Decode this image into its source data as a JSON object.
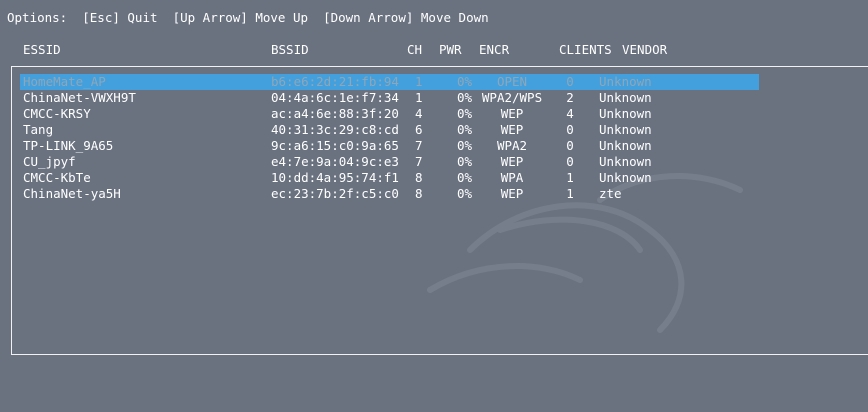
{
  "options_line": "Options:  [Esc] Quit  [Up Arrow] Move Up  [Down Arrow] Move Down",
  "columns": {
    "essid": "ESSID",
    "bssid": "BSSID",
    "ch": "CH",
    "pwr": "PWR",
    "encr": "ENCR",
    "clients": "CLIENTS",
    "vendor": "VENDOR"
  },
  "networks": [
    {
      "essid": "HomeMate_AP",
      "bssid": "b6:e6:2d:21:fb:94",
      "ch": "1",
      "pwr": "0%",
      "encr": "OPEN",
      "clients": "0",
      "vendor": "Unknown",
      "selected": true
    },
    {
      "essid": "ChinaNet-VWXH9T",
      "bssid": "04:4a:6c:1e:f7:34",
      "ch": "1",
      "pwr": "0%",
      "encr": "WPA2/WPS",
      "clients": "2",
      "vendor": "Unknown"
    },
    {
      "essid": "CMCC-KRSY",
      "bssid": "ac:a4:6e:88:3f:20",
      "ch": "4",
      "pwr": "0%",
      "encr": "WEP",
      "clients": "4",
      "vendor": "Unknown"
    },
    {
      "essid": "Tang",
      "bssid": "40:31:3c:29:c8:cd",
      "ch": "6",
      "pwr": "0%",
      "encr": "WEP",
      "clients": "0",
      "vendor": "Unknown"
    },
    {
      "essid": "TP-LINK_9A65",
      "bssid": "9c:a6:15:c0:9a:65",
      "ch": "7",
      "pwr": "0%",
      "encr": "WPA2",
      "clients": "0",
      "vendor": "Unknown"
    },
    {
      "essid": "CU_jpyf",
      "bssid": "e4:7e:9a:04:9c:e3",
      "ch": "7",
      "pwr": "0%",
      "encr": "WEP",
      "clients": "0",
      "vendor": "Unknown"
    },
    {
      "essid": "CMCC-KbTe",
      "bssid": "10:dd:4a:95:74:f1",
      "ch": "8",
      "pwr": "0%",
      "encr": "WPA",
      "clients": "1",
      "vendor": "Unknown"
    },
    {
      "essid": "ChinaNet-ya5H",
      "bssid": "ec:23:7b:2f:c5:c0",
      "ch": "8",
      "pwr": "0%",
      "encr": "WEP",
      "clients": "1",
      "vendor": "zte"
    }
  ]
}
